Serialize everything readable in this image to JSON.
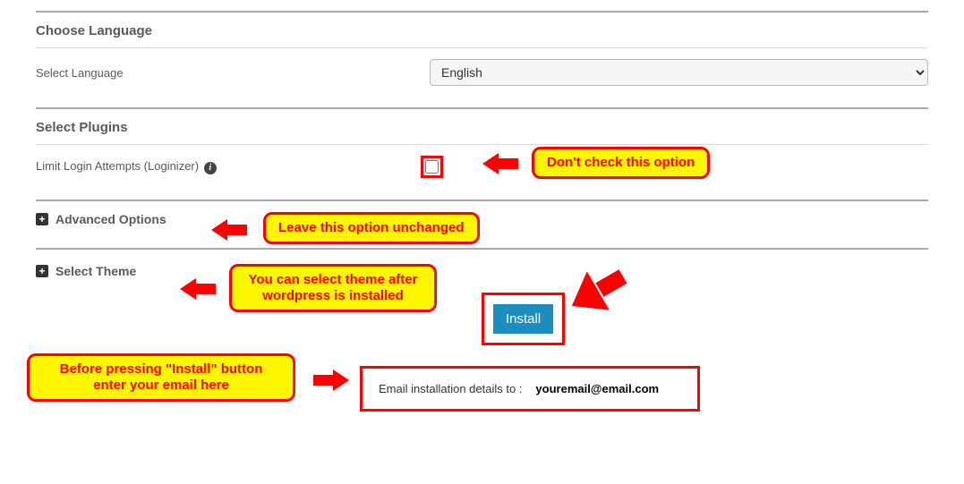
{
  "sections": {
    "language": {
      "title": "Choose Language",
      "label": "Select Language",
      "value": "English"
    },
    "plugins": {
      "title": "Select Plugins",
      "option_label": "Limit Login Attempts (Loginizer)"
    },
    "advanced": {
      "label": "Advanced Options"
    },
    "theme": {
      "label": "Select Theme"
    },
    "install_label": "Install",
    "email_label": "Email installation details to :",
    "email_value": "youremail@email.com"
  },
  "annotations": {
    "dont_check": "Don't check this option",
    "leave_unchanged": "Leave this option unchanged",
    "select_theme_note_line1": "You can  select theme after",
    "select_theme_note_line2": "wordpress is installed",
    "before_install_line1": "Before pressing \"Install\" button",
    "before_install_line2": "enter your email here"
  }
}
